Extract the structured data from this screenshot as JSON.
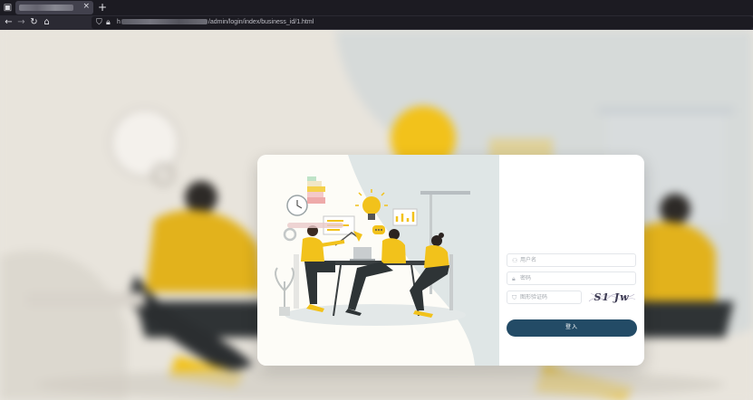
{
  "browser": {
    "tab_close": "×",
    "new_tab": "+",
    "address": {
      "prefix": "h",
      "path": "/admin/login/index/business_id/1.html"
    }
  },
  "login": {
    "username_placeholder": "用户名",
    "password_placeholder": "密码",
    "captcha_placeholder": "图形验证码",
    "captcha_text": "S1 Jw",
    "submit_label": "登入"
  },
  "colors": {
    "accent": "#234b66",
    "illustration_yellow": "#f2c21b",
    "background": "#e9e5de"
  },
  "icons": {
    "browser_menu": "browser-menu-icon",
    "back": "back-arrow-icon",
    "forward": "forward-arrow-icon",
    "reload": "reload-icon",
    "home": "home-icon",
    "shield": "shield-icon",
    "lock": "lock-icon",
    "user": "user-icon",
    "password": "lock-icon",
    "captcha": "shield-check-icon"
  }
}
